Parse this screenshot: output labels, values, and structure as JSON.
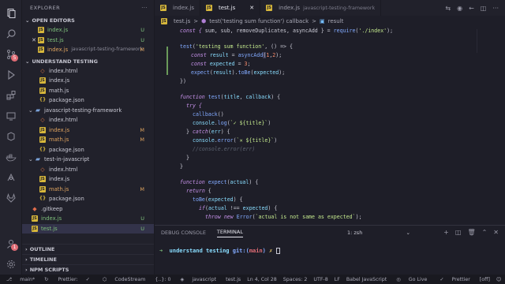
{
  "sidebar": {
    "title": "EXPLORER",
    "open_editors": {
      "label": "OPEN EDITORS",
      "items": [
        {
          "name": "index.js",
          "status": "U"
        },
        {
          "name": "test.js",
          "status": "U"
        },
        {
          "name": "index.js",
          "detail": "javascript-testing-framework",
          "status": "M"
        }
      ]
    },
    "project": {
      "label": "UNDERSTAND TESTING",
      "root_files": [
        {
          "name": "index.html"
        },
        {
          "name": "index.js"
        },
        {
          "name": "math.js"
        },
        {
          "name": "package.json"
        }
      ],
      "folder1": {
        "name": "javascript-testing-framework",
        "files": [
          {
            "name": "index.html"
          },
          {
            "name": "index.js",
            "status": "M"
          },
          {
            "name": "math.js",
            "status": "M"
          },
          {
            "name": "package.json"
          }
        ]
      },
      "folder2": {
        "name": "test-in-javascript",
        "files": [
          {
            "name": "index.html"
          },
          {
            "name": "index.js"
          },
          {
            "name": "math.js",
            "status": "M"
          },
          {
            "name": "package.json"
          }
        ]
      },
      "bottom_files": [
        {
          "name": ".gitkeep"
        },
        {
          "name": "index.js",
          "status": "U"
        },
        {
          "name": "test.js",
          "status": "U"
        }
      ]
    },
    "outline": "OUTLINE",
    "timeline": "TIMELINE",
    "npm": "NPM SCRIPTS"
  },
  "activity_badges": {
    "scm": "5",
    "account": "1"
  },
  "tabs": [
    {
      "label": "index.js",
      "detail": ""
    },
    {
      "label": "test.js",
      "detail": ""
    },
    {
      "label": "index.js",
      "detail": "javascript-testing-framework"
    }
  ],
  "breadcrumb": {
    "file": "test.js",
    "sep1": ">",
    "fn": "test('testing sum function') callback",
    "sep2": ">",
    "var": "result"
  },
  "code": {
    "l1": [
      "const { ",
      "sum",
      ", ",
      "sub",
      ", ",
      "removeDuplicates",
      ", ",
      "asyncAdd",
      " } = ",
      "require",
      "(",
      "'./index'",
      ");"
    ],
    "l2": [
      "test",
      "(",
      "'testing sum function'",
      ", () => {"
    ],
    "l3": [
      "const ",
      "result",
      " = ",
      "asyncAdd",
      "(",
      "1",
      ",",
      "2",
      ");"
    ],
    "l4": [
      "const ",
      "expected",
      " = ",
      "3",
      ";"
    ],
    "l5": [
      "expect",
      "(",
      "result",
      ").",
      "toBe",
      "(",
      "expected",
      ");"
    ],
    "l6": "})",
    "l7": [
      "function ",
      "test",
      "(",
      "title",
      ", ",
      "callback",
      ") {"
    ],
    "l8": "try {",
    "l9": [
      "callback",
      "()"
    ],
    "l10": [
      "console",
      ".",
      "log",
      "(",
      "`✓ ${title}`",
      ")"
    ],
    "l11": [
      "} ",
      "catch",
      "(",
      "err",
      ") {"
    ],
    "l12": [
      "console",
      ".",
      "error",
      "(",
      "`✕ ${title}`",
      ")"
    ],
    "l13": "//console.error(err)",
    "l14": "}",
    "l15": "}",
    "l16": [
      "function ",
      "expect",
      "(",
      "actual",
      ") {"
    ],
    "l17": [
      "return",
      " {"
    ],
    "l18": [
      "toBe",
      "(",
      "expected",
      ") {"
    ],
    "l19": [
      "if",
      "(",
      "actual",
      " !== ",
      "expected",
      ") {"
    ],
    "l20": [
      "throw ",
      "new ",
      "Error",
      "(",
      "`actual is not same as expected`",
      ");"
    ],
    "l21": "}"
  },
  "panel": {
    "tab_debug": "DEBUG CONSOLE",
    "tab_terminal": "TERMINAL",
    "terminal_select": "1: zsh",
    "prompt_arrow": "➜",
    "prompt_dir": "understand testing",
    "prompt_git": "git:(",
    "prompt_branch": "main",
    "prompt_git_close": ")",
    "prompt_mark": "✗"
  },
  "statusbar": {
    "branch": "main*",
    "prettier_left": "Prettier:",
    "check": "✓",
    "codestream": "CodeStream",
    "brackets": "{..}: 0",
    "language": "javascript",
    "file": "test.js",
    "position": "Ln 4, Col 28",
    "spaces": "Spaces: 2",
    "encoding": "UTF-8",
    "eol": "LF",
    "mode": "Babel JavaScript",
    "golive": "Go Live",
    "prettier_right": "Prettier",
    "eslint": "[off]"
  }
}
